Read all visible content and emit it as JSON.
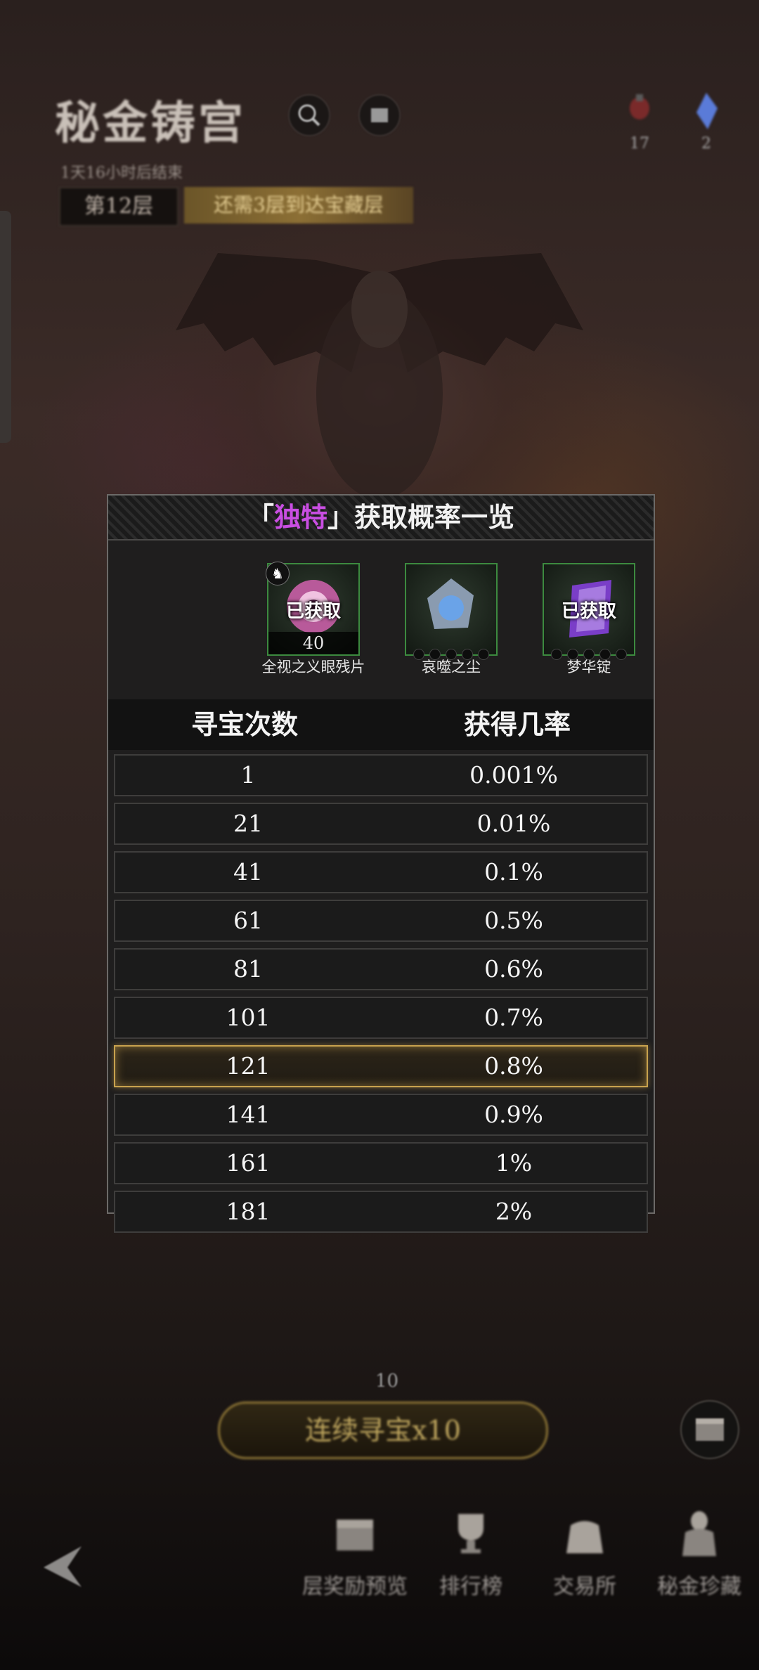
{
  "header": {
    "title": "秘金铸宫",
    "subtitle": "1天16小时后结束",
    "floor": "第12层",
    "floor_tip": "还需3层到达宝藏层",
    "search_icon": "magnifier-icon",
    "info_icon": "info-icon"
  },
  "resources": [
    {
      "icon": "potion-icon",
      "count": "17"
    },
    {
      "icon": "crystal-icon",
      "count": "2"
    }
  ],
  "modal": {
    "title_prefix": "「",
    "title_highlight": "独特",
    "title_suffix": "」获取概率一览",
    "accent_color": "#c94ee2",
    "items": [
      {
        "name": "全视之义眼残片",
        "owned_label": "已获取",
        "count": "40",
        "icon": "eye-orb-icon"
      },
      {
        "name": "哀噬之尘",
        "icon": "silver-dust-icon"
      },
      {
        "name": "梦华锭",
        "owned_label": "已获取",
        "icon": "purple-ingot-icon"
      }
    ],
    "table": {
      "col1_header": "寻宝次数",
      "col2_header": "获得几率",
      "rows": [
        {
          "count": "1",
          "rate": "0.001%"
        },
        {
          "count": "21",
          "rate": "0.01%"
        },
        {
          "count": "41",
          "rate": "0.1%"
        },
        {
          "count": "61",
          "rate": "0.5%"
        },
        {
          "count": "81",
          "rate": "0.6%"
        },
        {
          "count": "101",
          "rate": "0.7%"
        },
        {
          "count": "121",
          "rate": "0.8%"
        },
        {
          "count": "141",
          "rate": "0.9%"
        },
        {
          "count": "161",
          "rate": "1%"
        },
        {
          "count": "181",
          "rate": "2%"
        }
      ],
      "highlighted_row": "121",
      "highlight_color": "#c8a24e"
    }
  },
  "bottom": {
    "remaining": "10",
    "draw_button": "连续寻宝x10",
    "nav": [
      {
        "label": "层奖励预览",
        "icon": "chest-icon"
      },
      {
        "label": "排行榜",
        "icon": "trophy-icon"
      },
      {
        "label": "交易所",
        "icon": "bag-icon"
      },
      {
        "label": "秘金珍藏",
        "icon": "statue-icon"
      }
    ],
    "back_icon": "back-arrow-icon"
  }
}
